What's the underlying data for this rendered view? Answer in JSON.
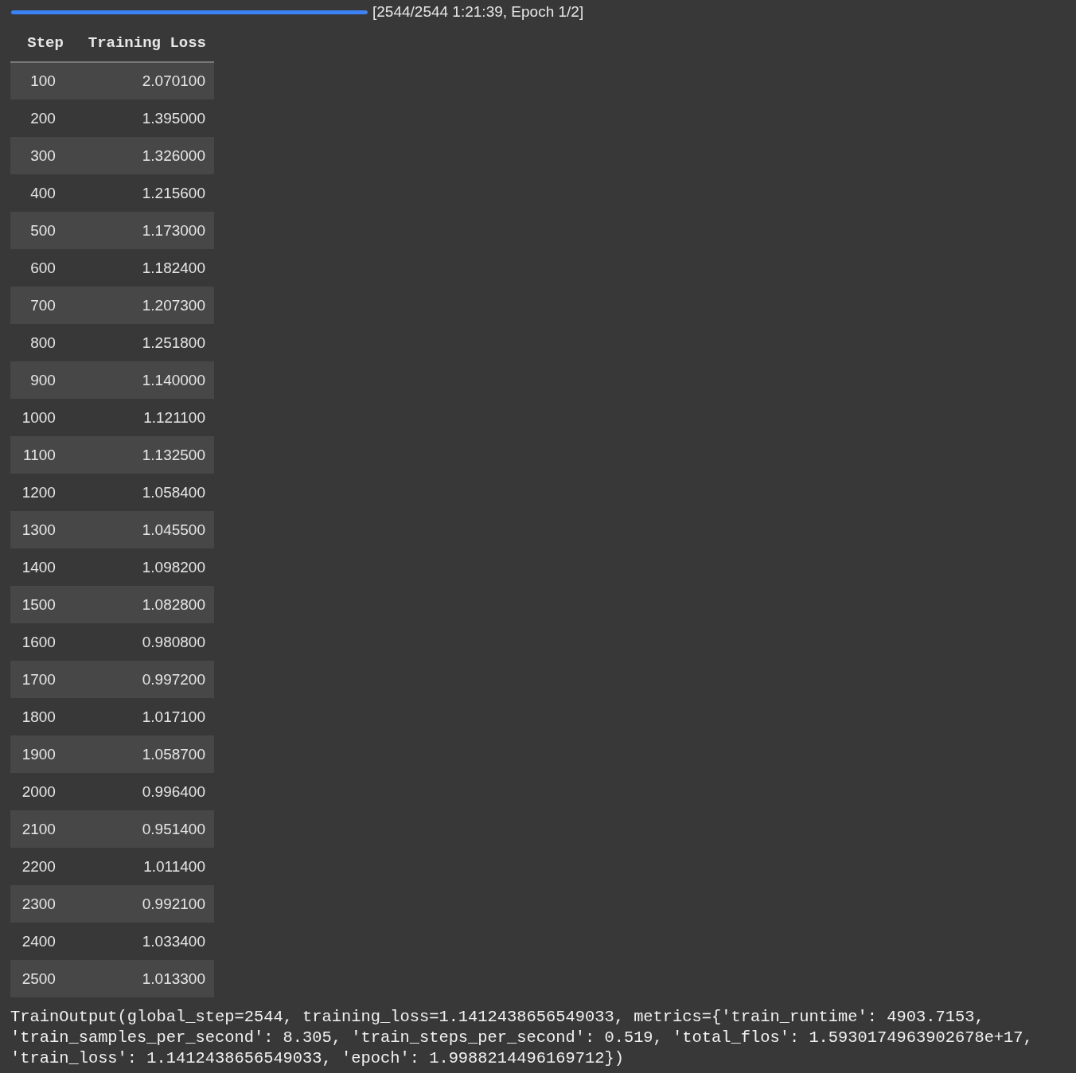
{
  "progress": {
    "level": 1,
    "label": "[2544/2544 1:21:39, Epoch 1/2]"
  },
  "table": {
    "columns": [
      "Step",
      "Training Loss"
    ],
    "rows": [
      {
        "step": "100",
        "loss": "2.070100"
      },
      {
        "step": "200",
        "loss": "1.395000"
      },
      {
        "step": "300",
        "loss": "1.326000"
      },
      {
        "step": "400",
        "loss": "1.215600"
      },
      {
        "step": "500",
        "loss": "1.173000"
      },
      {
        "step": "600",
        "loss": "1.182400"
      },
      {
        "step": "700",
        "loss": "1.207300"
      },
      {
        "step": "800",
        "loss": "1.251800"
      },
      {
        "step": "900",
        "loss": "1.140000"
      },
      {
        "step": "1000",
        "loss": "1.121100"
      },
      {
        "step": "1100",
        "loss": "1.132500"
      },
      {
        "step": "1200",
        "loss": "1.058400"
      },
      {
        "step": "1300",
        "loss": "1.045500"
      },
      {
        "step": "1400",
        "loss": "1.098200"
      },
      {
        "step": "1500",
        "loss": "1.082800"
      },
      {
        "step": "1600",
        "loss": "0.980800"
      },
      {
        "step": "1700",
        "loss": "0.997200"
      },
      {
        "step": "1800",
        "loss": "1.017100"
      },
      {
        "step": "1900",
        "loss": "1.058700"
      },
      {
        "step": "2000",
        "loss": "0.996400"
      },
      {
        "step": "2100",
        "loss": "0.951400"
      },
      {
        "step": "2200",
        "loss": "1.011400"
      },
      {
        "step": "2300",
        "loss": "0.992100"
      },
      {
        "step": "2400",
        "loss": "1.033400"
      },
      {
        "step": "2500",
        "loss": "1.013300"
      }
    ]
  },
  "output": {
    "lines": [
      "TrainOutput(global_step=2544, training_loss=1.1412438656549033, metrics={'train_runtime': 4903.7153,",
      "'train_samples_per_second': 8.305, 'train_steps_per_second': 0.519, 'total_flos': 1.5930174963902678e+17,",
      "'train_loss': 1.1412438656549033, 'epoch': 1.9988214496169712})"
    ]
  }
}
